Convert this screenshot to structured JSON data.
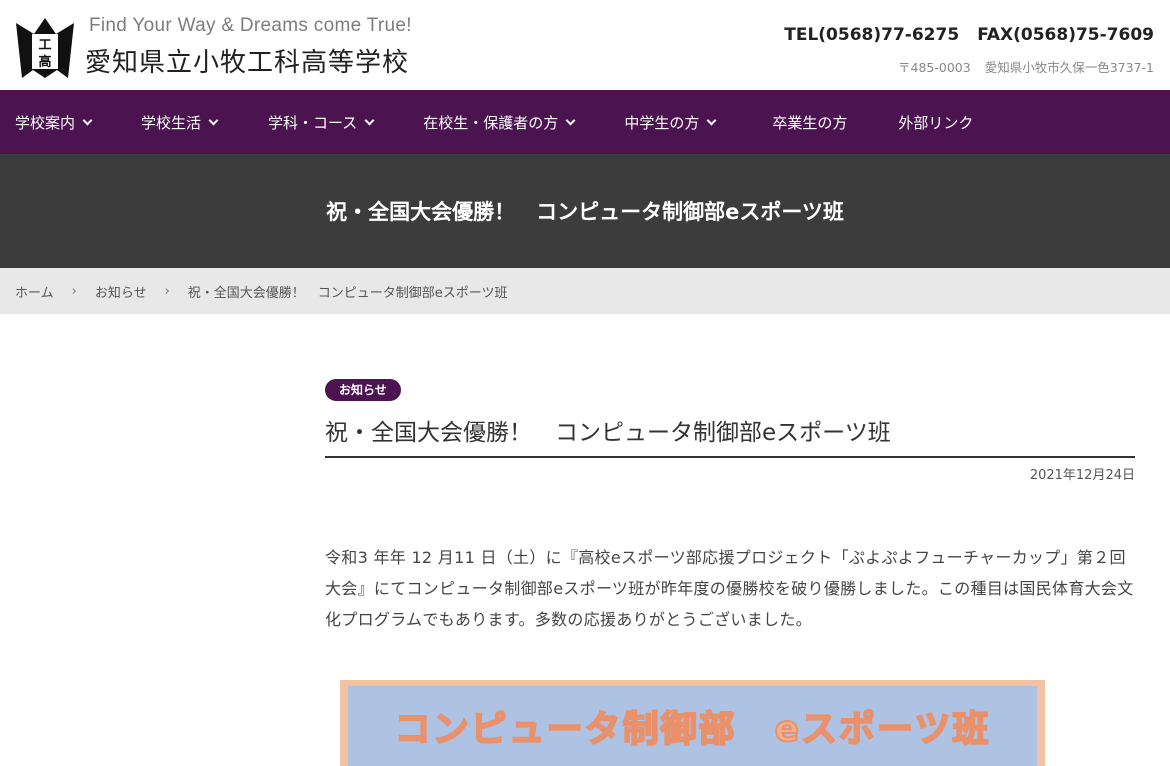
{
  "header": {
    "tagline": "Find Your Way & Dreams come True!",
    "school_name": "愛知県立小牧工科高等学校",
    "logo_text": "工高",
    "tel": "TEL(0568)77-6275",
    "fax": "FAX(0568)75-7609",
    "postal": "〒485-0003",
    "address": "愛知県小牧市久保一色3737-1"
  },
  "nav": {
    "items": [
      {
        "label": "学校案内",
        "has_dropdown": true
      },
      {
        "label": "学校生活",
        "has_dropdown": true
      },
      {
        "label": "学科・コース",
        "has_dropdown": true
      },
      {
        "label": "在校生・保護者の方",
        "has_dropdown": true
      },
      {
        "label": "中学生の方",
        "has_dropdown": true
      },
      {
        "label": "卒業生の方",
        "has_dropdown": false
      },
      {
        "label": "外部リンク",
        "has_dropdown": false
      }
    ]
  },
  "page_title": "祝・全国大会優勝！　コンピュータ制御部eスポーツ班",
  "breadcrumb": {
    "home": "ホーム",
    "category": "お知らせ",
    "current": "祝・全国大会優勝！　コンピュータ制御部eスポーツ班",
    "separator": "›"
  },
  "article": {
    "category_badge": "お知らせ",
    "title": "祝・全国大会優勝！　コンピュータ制御部eスポーツ班",
    "date": "2021年12月24日",
    "body": "令和3 年年 12 月11 日（土）に『高校eスポーツ部応援プロジェクト「ぷよぷよフューチャーカップ」第２回大会』にてコンピュータ制御部eスポーツ班が昨年度の優勝校を破り優勝しました。この種目は国民体育大会文化プログラムでもあります。多数の応援ありがとうございました。",
    "banner_text": "コンピュータ制御部　eスポーツ班"
  },
  "colors": {
    "nav_bg": "#4b1451",
    "title_band_bg": "#3c3c3c",
    "breadcrumb_bg": "#e8e8e8",
    "badge_bg": "#4b1451",
    "banner_border": "#f2c3a2",
    "banner_bg": "#aec2e4"
  }
}
